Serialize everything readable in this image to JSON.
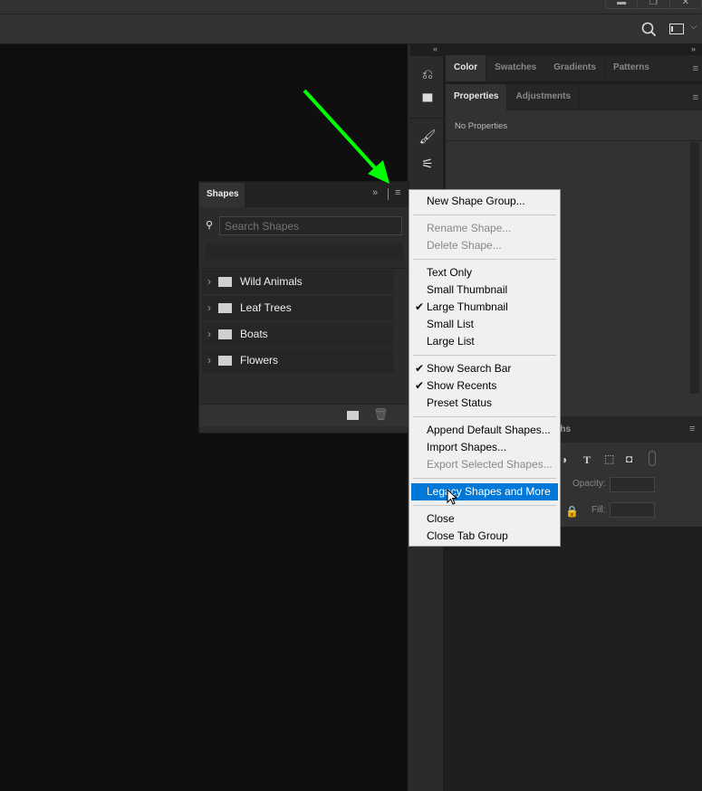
{
  "window": {
    "controls": [
      "minimize",
      "restore",
      "close"
    ]
  },
  "optionsbar": {
    "icons": [
      "search-icon",
      "workspace-icon",
      "chevron-down-icon"
    ]
  },
  "dock": {
    "color_tabs": [
      {
        "label": "Color",
        "active": true
      },
      {
        "label": "Swatches"
      },
      {
        "label": "Gradients"
      },
      {
        "label": "Patterns"
      }
    ],
    "properties_tabs": [
      {
        "label": "Properties",
        "active": true
      },
      {
        "label": "Adjustments"
      }
    ],
    "properties_text": "No Properties",
    "layers_tab_partial": "ths",
    "opacity_label": "Opacity:",
    "fill_label": "Fill:"
  },
  "shapes": {
    "tab": "Shapes",
    "search_placeholder": "Search Shapes",
    "groups": [
      "Wild Animals",
      "Leaf Trees",
      "Boats",
      "Flowers"
    ]
  },
  "menu": {
    "items": [
      {
        "label": "New Shape Group..."
      },
      {
        "label": "Rename Shape...",
        "disabled": true
      },
      {
        "label": "Delete Shape...",
        "disabled": true
      },
      {
        "label": "Text Only"
      },
      {
        "label": "Small Thumbnail"
      },
      {
        "label": "Large Thumbnail",
        "checked": true
      },
      {
        "label": "Small List"
      },
      {
        "label": "Large List"
      },
      {
        "label": "Show Search Bar",
        "checked": true
      },
      {
        "label": "Show Recents",
        "checked": true
      },
      {
        "label": "Preset Status"
      },
      {
        "label": "Append Default Shapes..."
      },
      {
        "label": "Import Shapes..."
      },
      {
        "label": "Export Selected Shapes...",
        "disabled": true
      },
      {
        "label": "Legacy Shapes and More",
        "highlighted": true
      },
      {
        "label": "Close"
      },
      {
        "label": "Close Tab Group"
      }
    ],
    "check_glyph": "✔"
  },
  "colors": {
    "highlight": "#0078d7",
    "arrow": "#00ff00"
  }
}
